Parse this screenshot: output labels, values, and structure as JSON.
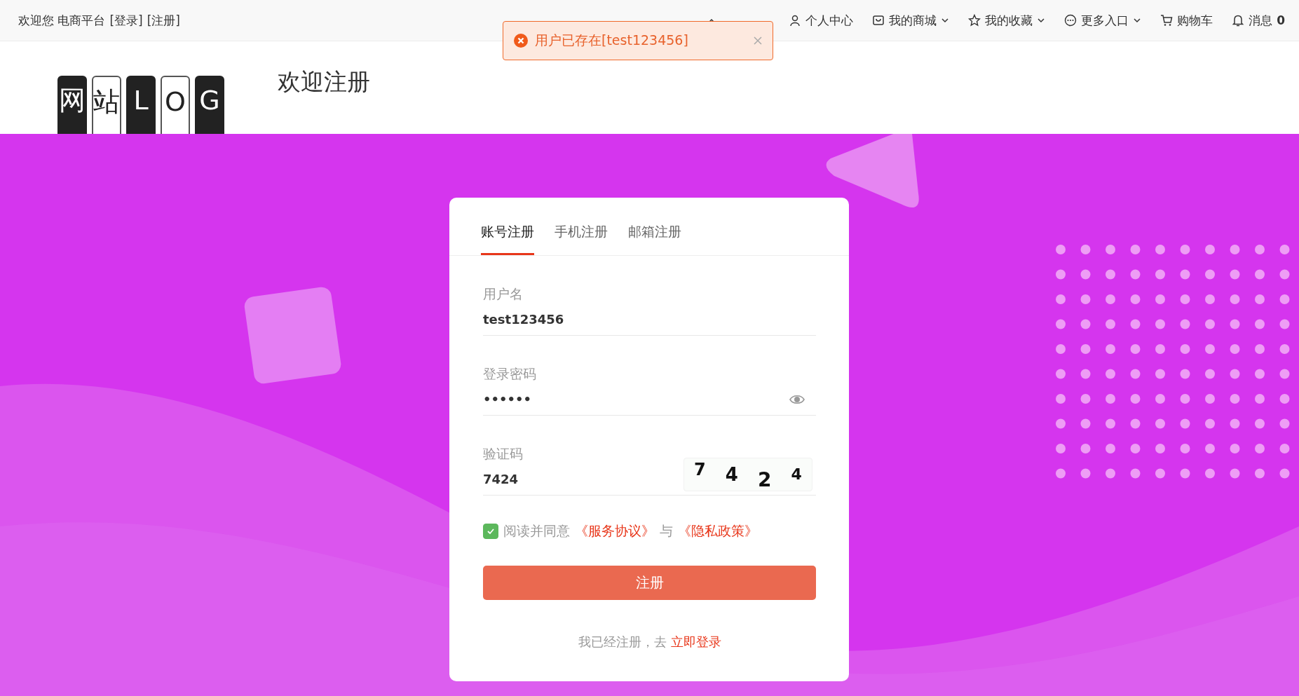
{
  "top_bar": {
    "welcome": "欢迎您 电商平台",
    "links": [
      "[登录]",
      "[注册]"
    ]
  },
  "nav": [
    {
      "kind": "covered"
    },
    {
      "label": "个人中心",
      "dropdown": false
    },
    {
      "label": "我的商城",
      "dropdown": true
    },
    {
      "label": "我的收藏",
      "dropdown": true
    },
    {
      "label": "更多入口",
      "dropdown": true
    },
    {
      "label": "购物车",
      "dropdown": false
    },
    {
      "label": "消息",
      "count": "0",
      "dropdown": false
    }
  ],
  "toast": {
    "kind": "error",
    "message": "用户已存在[test123456]"
  },
  "header": {
    "logo": [
      {
        "char": "网",
        "dark": true
      },
      {
        "char": "站",
        "dark": false
      },
      {
        "char": "L",
        "dark": true
      },
      {
        "char": "O",
        "dark": false
      },
      {
        "char": "G",
        "dark": true
      }
    ],
    "title": "欢迎注册"
  },
  "tabs": [
    {
      "label": "账号注册",
      "selected": true
    },
    {
      "label": "手机注册",
      "selected": false
    },
    {
      "label": "邮箱注册",
      "selected": false
    }
  ],
  "fields": [
    {
      "kind": "text",
      "label": "用户名",
      "value": "test123456"
    },
    {
      "kind": "password",
      "label": "登录密码",
      "value": "••••••"
    },
    {
      "kind": "captcha",
      "label": "验证码",
      "value": "7424",
      "captcha": [
        "7",
        "4",
        "2",
        "4"
      ]
    }
  ],
  "agreement": {
    "checked": true,
    "text": "阅读并同意",
    "links": [
      "《服务协议》",
      "《隐私政策》"
    ],
    "joiner": "与"
  },
  "submit": "注册",
  "footer": {
    "text": "我已经注册，去",
    "link": "立即登录"
  }
}
